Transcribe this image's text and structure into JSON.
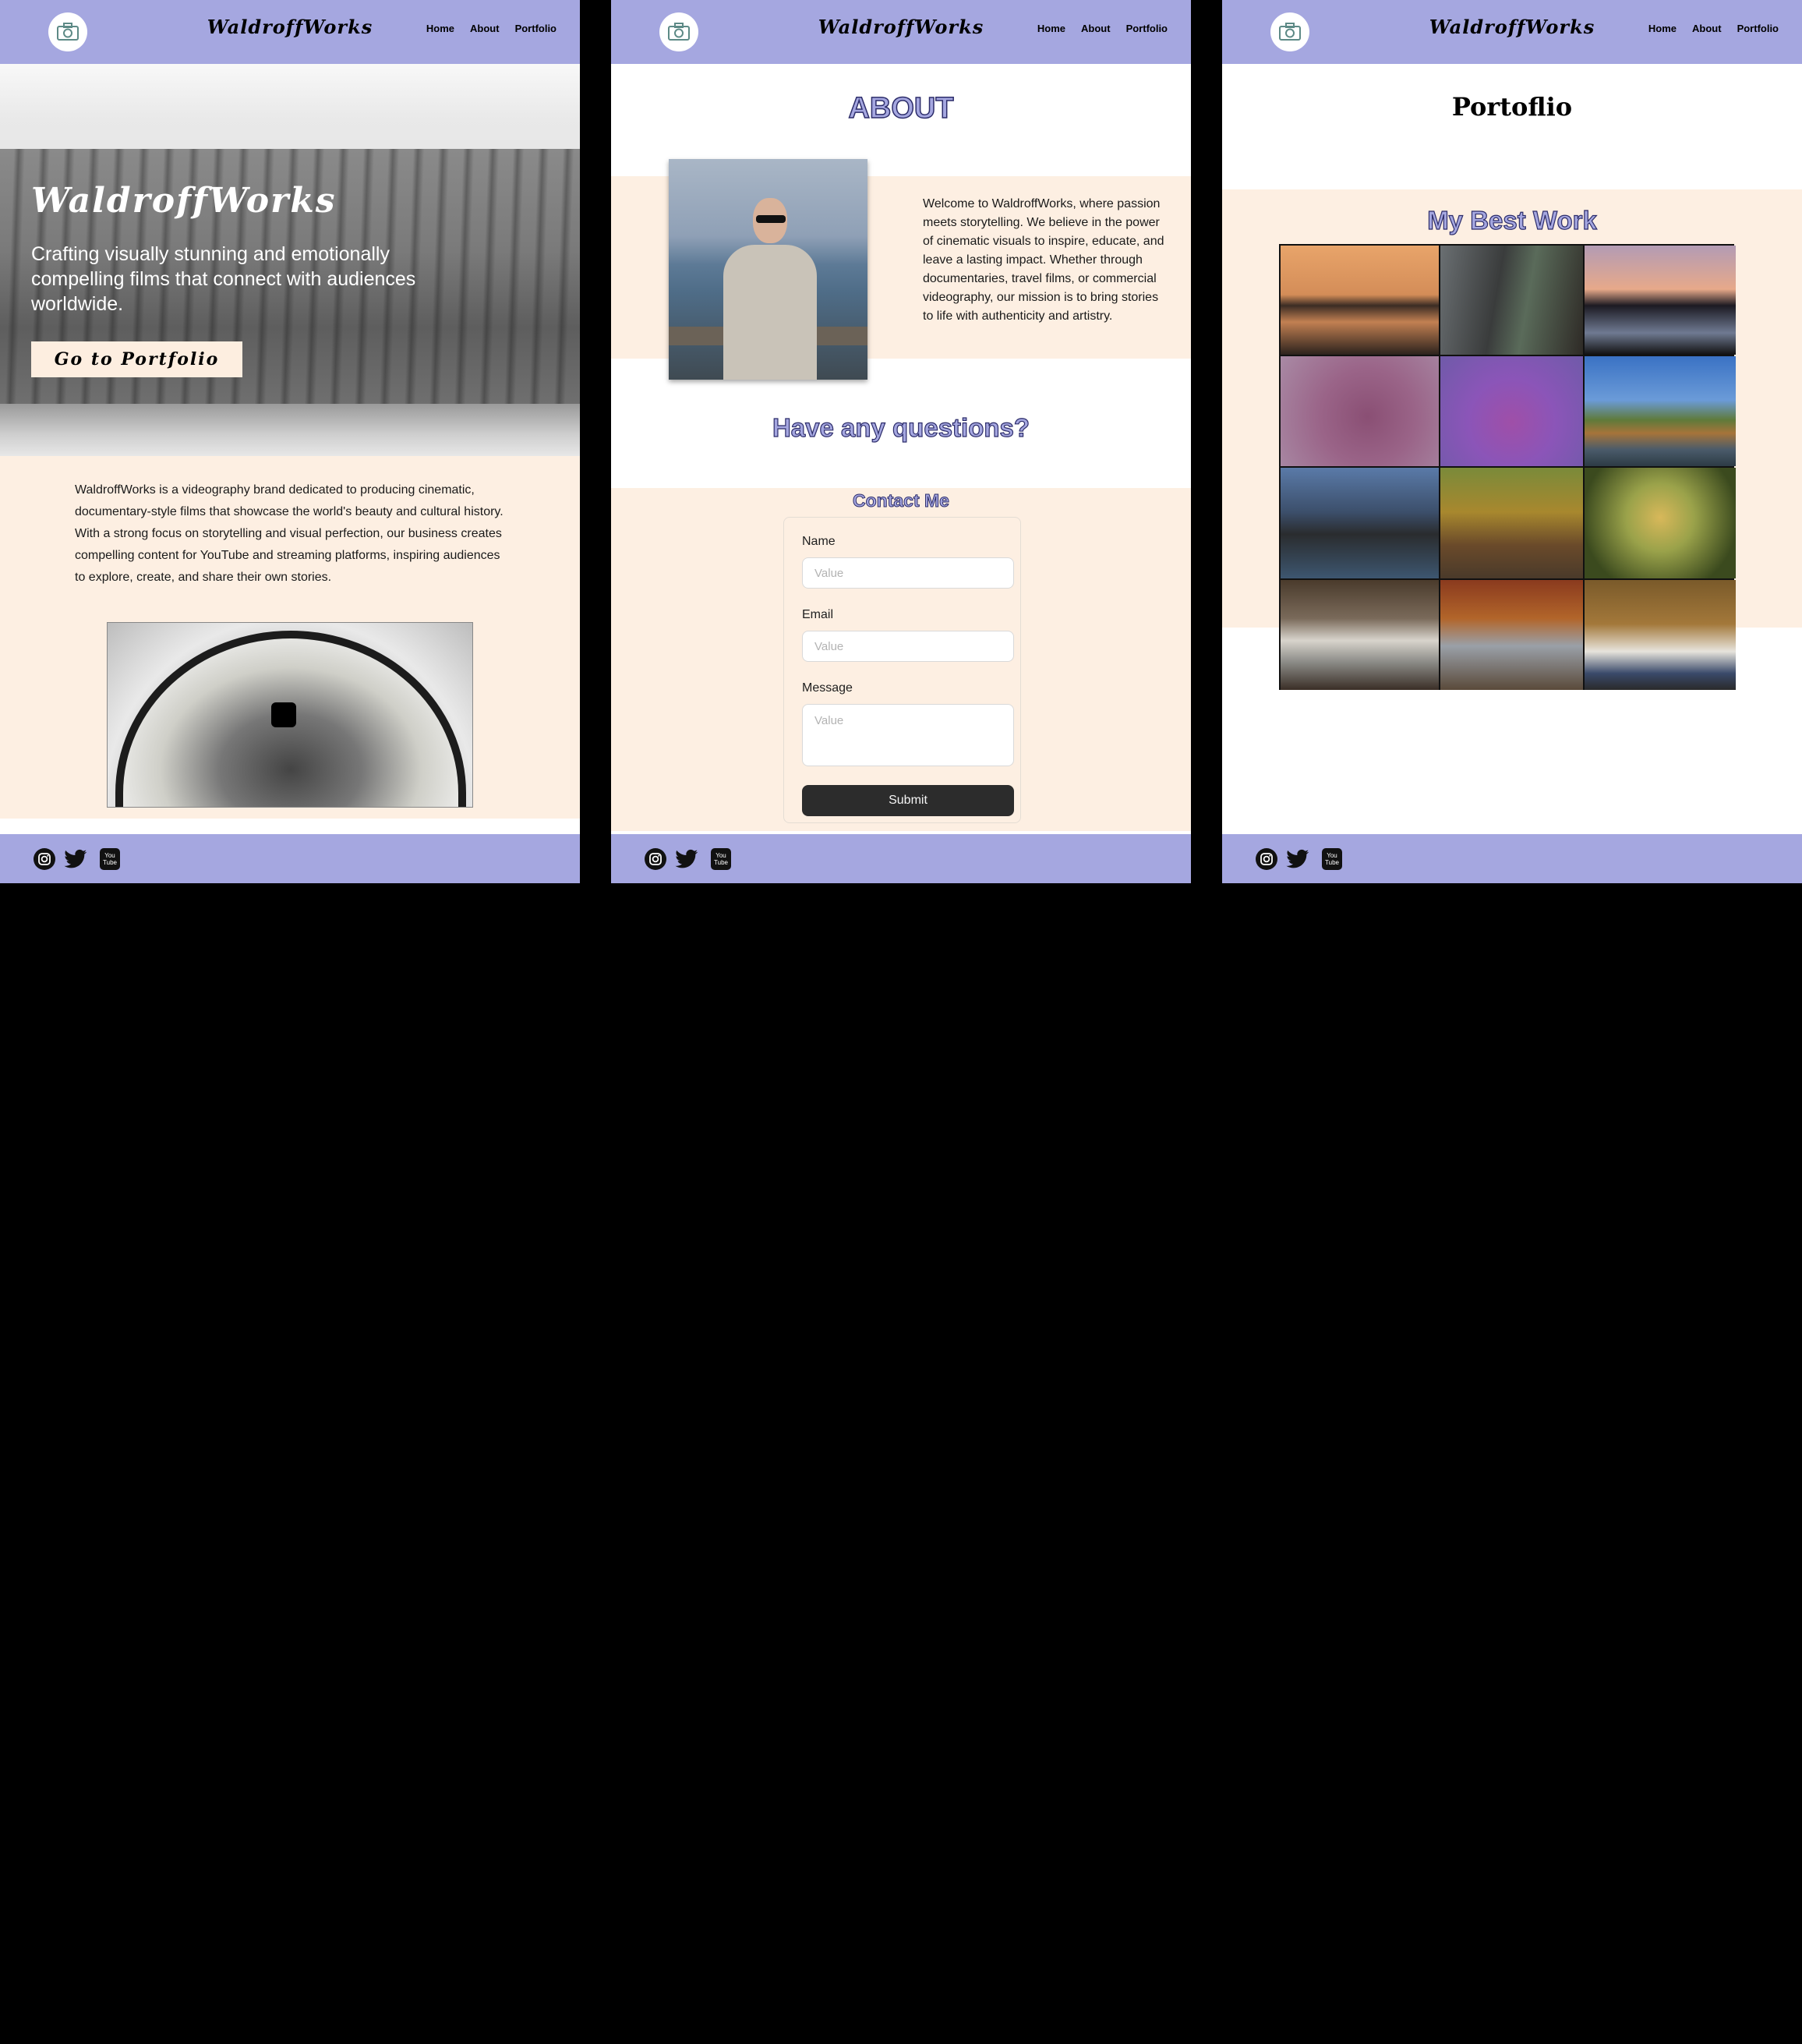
{
  "brand": "WaldroffWorks",
  "nav": {
    "home": "Home",
    "about": "About",
    "portfolio": "Portfolio"
  },
  "icons": {
    "logo": "camera-icon",
    "social": [
      "instagram-icon",
      "twitter-icon",
      "youtube-icon"
    ]
  },
  "colors": {
    "header": "#a5a7e0",
    "cream": "#fdefe2",
    "outline_text": "#2c2c6a",
    "submit": "#2c2c2c"
  },
  "home": {
    "hero_title": "WaldroffWorks",
    "hero_subtitle": "Crafting visually stunning and emotionally compelling films that connect with audiences worldwide.",
    "cta": "Go to Portfolio",
    "description": "WaldroffWorks is a videography brand dedicated to producing cinematic, documentary-style films that showcase the world's beauty and cultural history. With a strong focus on storytelling and visual perfection, our business creates compelling content for YouTube and streaming platforms, inspiring audiences to explore, create, and share their own stories."
  },
  "about": {
    "title": "ABOUT",
    "text": "Welcome to WaldroffWorks, where passion meets storytelling. We believe in the power of cinematic visuals to inspire, educate, and leave a lasting impact. Whether through documentaries, travel films, or commercial videography, our mission is to bring stories to life with authenticity and artistry.",
    "questions": "Have any questions?",
    "contact_title": "Contact Me",
    "form": {
      "name_label": "Name",
      "name_placeholder": "Value",
      "email_label": "Email",
      "email_placeholder": "Value",
      "message_label": "Message",
      "message_placeholder": "Value",
      "submit": "Submit"
    }
  },
  "portfolio": {
    "title": "Portoflio",
    "heading": "My Best Work",
    "tiles": [
      "sunset-lake-geese",
      "hallway-people",
      "forest-lake-dusk",
      "plane-pink-sky",
      "plane-purple-sky",
      "autumn-forest-lake",
      "boathouse-lake",
      "couple-autumn",
      "maple-leaves",
      "waterfall",
      "person-autumn-woods",
      "man-on-bench"
    ]
  }
}
